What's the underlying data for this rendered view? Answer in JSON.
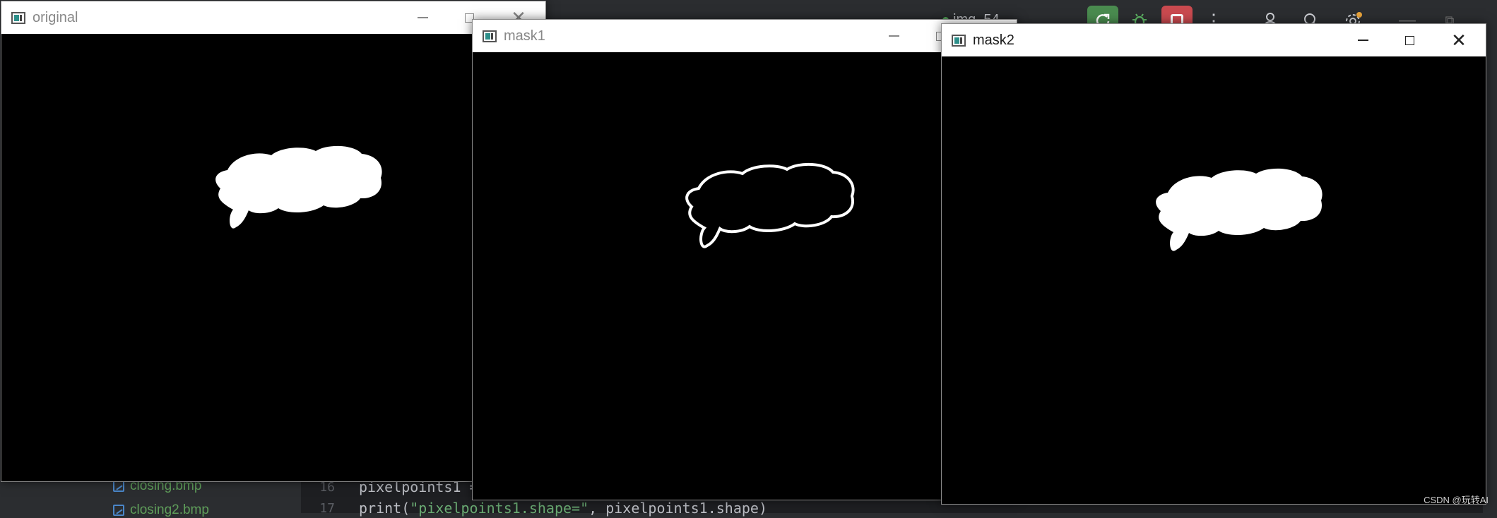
{
  "windows": {
    "original": {
      "title": "original"
    },
    "mask1": {
      "title": "mask1"
    },
    "mask2": {
      "title": "mask2"
    }
  },
  "window_controls": {
    "minimize": "—",
    "close": "✕"
  },
  "ide": {
    "run_config": "img_54",
    "files": [
      {
        "name": "closing.bmp"
      },
      {
        "name": "closing2.bmp"
      }
    ],
    "code": [
      {
        "line": "16",
        "text": "pixelpoints1 ="
      },
      {
        "line": "17",
        "text_prefix": "print(",
        "text_string": "\"pixelpoints1.shape=\"",
        "text_suffix": ", pixelpoints1.shape)"
      }
    ]
  },
  "watermark": "CSDN @玩转AI"
}
